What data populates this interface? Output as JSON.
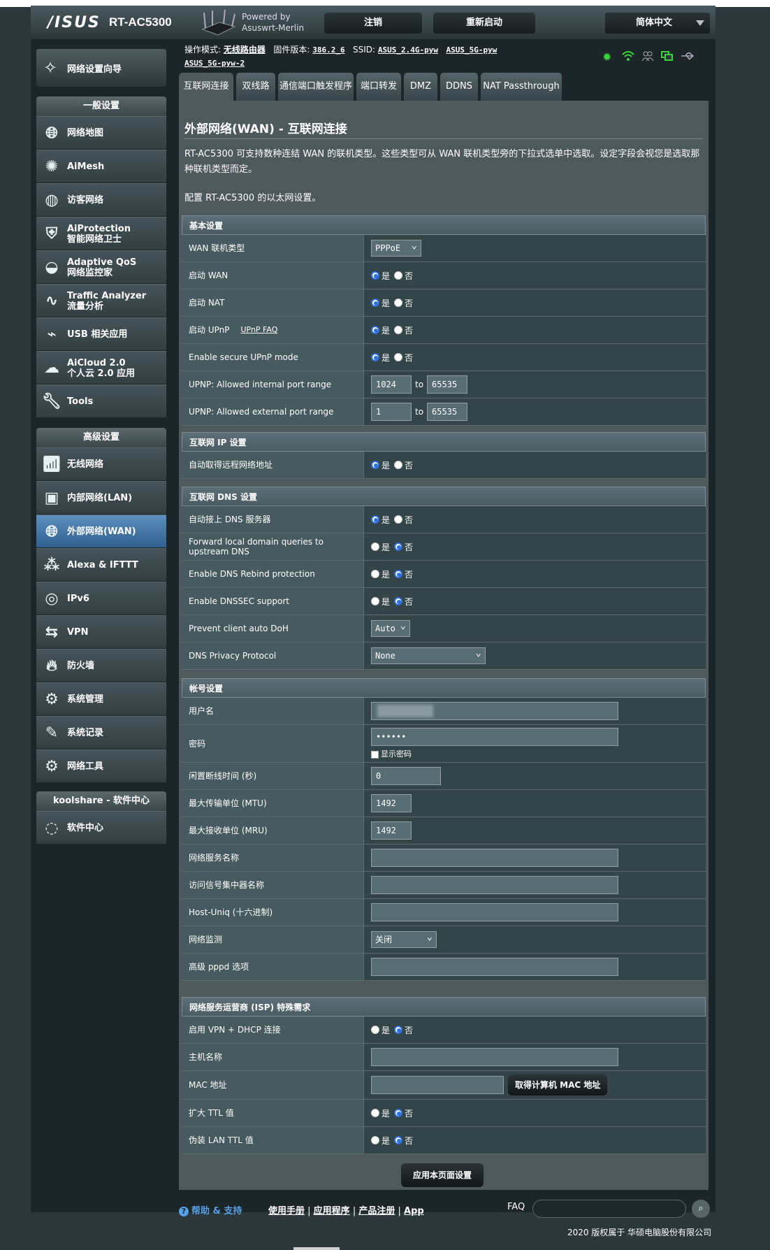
{
  "header": {
    "brand": "/ISUS",
    "model": "RT-AC5300",
    "powered_by_line1": "Powered by",
    "powered_by_line2": "Asuswrt-Merlin",
    "logout": "注销",
    "reboot": "重新启动",
    "language": "简体中文"
  },
  "opline": {
    "mode_label": "操作模式:",
    "mode_value": "无线路由器",
    "fw_label": "固件版本:",
    "fw_value": "386.2_6",
    "ssid_label": "SSID:",
    "ssid1": "ASUS_2.4G-pyw",
    "ssid2": "ASUS_5G-pyw",
    "ssid3": "ASUS_5G-pyw-2"
  },
  "sidebar": {
    "qis": "网络设置向导",
    "general_title": "一般设置",
    "general_items": [
      {
        "label": "网络地图",
        "icon": "globe"
      },
      {
        "label": "AiMesh",
        "icon": "mesh"
      },
      {
        "label": "访客网络",
        "icon": "guest"
      },
      {
        "label1": "AiProtection",
        "label2": "智能网络卫士",
        "icon": "shield"
      },
      {
        "label1": "Adaptive QoS",
        "label2": "网络监控家",
        "icon": "gauge"
      },
      {
        "label1": "Traffic Analyzer",
        "label2": "流量分析",
        "icon": "pulse"
      },
      {
        "label": "USB 相关应用",
        "icon": "usb"
      },
      {
        "label1": "AiCloud 2.0",
        "label2": "个人云 2.0 应用",
        "icon": "cloud"
      },
      {
        "label": "Tools",
        "icon": "wrench"
      }
    ],
    "advanced_title": "高级设置",
    "advanced_items": [
      {
        "label": "无线网络",
        "icon": "wifi"
      },
      {
        "label": "内部网络(LAN)",
        "icon": "lan"
      },
      {
        "label": "外部网络(WAN)",
        "icon": "wan"
      },
      {
        "label": "Alexa & IFTTT",
        "icon": "alexa"
      },
      {
        "label": "IPv6",
        "icon": "ipv6"
      },
      {
        "label": "VPN",
        "icon": "vpn"
      },
      {
        "label": "防火墙",
        "icon": "fire"
      },
      {
        "label": "系统管理",
        "icon": "admin"
      },
      {
        "label": "系统记录",
        "icon": "log"
      },
      {
        "label": "网络工具",
        "icon": "tools"
      }
    ],
    "koolshare_title": "koolshare - 软件中心",
    "koolshare_item": "软件中心"
  },
  "tabs": [
    "互联网连接",
    "双线路",
    "通信端口触发程序",
    "端口转发",
    "DMZ",
    "DDNS",
    "NAT Passthrough"
  ],
  "content": {
    "title": "外部网络(WAN) - 互联网连接",
    "desc": "RT-AC5300 可支持数种连结 WAN 的联机类型。这些类型可从 WAN 联机类型旁的下拉式选单中选取。设定字段会视您是选取那种联机类型而定。",
    "desc2": "配置 RT-AC5300 的以太网设置。",
    "yes": "是",
    "no": "否",
    "to": "to"
  },
  "basic": {
    "title": "基本设置",
    "wan_type_label": "WAN 联机类型",
    "wan_type_value": "PPPoE",
    "enable_wan": "启动 WAN",
    "enable_nat": "启动 NAT",
    "enable_upnp": "启动 UPnP",
    "upnp_faq": "UPnP FAQ",
    "secure_upnp": "Enable secure UPnP mode",
    "internal_range": "UPNP: Allowed internal port range",
    "internal_from": "1024",
    "internal_to": "65535",
    "external_range": "UPNP: Allowed external port range",
    "external_from": "1",
    "external_to": "65535"
  },
  "ip": {
    "title": "互联网 IP 设置",
    "auto_ip": "自动取得远程网络地址"
  },
  "dns": {
    "title": "互联网 DNS 设置",
    "auto_dns": "自动接上 DNS 服务器",
    "forward_local": "Forward local domain queries to upstream DNS",
    "rebind": "Enable DNS Rebind protection",
    "dnssec": "Enable DNSSEC support",
    "doh": "Prevent client auto DoH",
    "doh_value": "Auto",
    "privacy": "DNS Privacy Protocol",
    "privacy_value": "None"
  },
  "account": {
    "title": "帐号设置",
    "username": "用户名",
    "password": "密码",
    "password_value": "••••••",
    "show_password": "显示密码",
    "idle": "闲置断线时间 (秒)",
    "idle_value": "0",
    "mtu": "最大传输单位 (MTU)",
    "mtu_value": "1492",
    "mru": "最大接收单位 (MRU)",
    "mru_value": "1492",
    "service_name": "网络服务名称",
    "ac_name": "访问信号集中器名称",
    "host_uniq": "Host-Uniq (十六进制)",
    "monitor": "网络监测",
    "monitor_value": "关闭",
    "pppd": "高级 pppd 选项"
  },
  "isp": {
    "title": "网络服务运营商 (ISP) 特殊需求",
    "vpn_dhcp": "启用 VPN + DHCP 连接",
    "hostname": "主机名称",
    "mac": "MAC 地址",
    "mac_button": "取得计算机 MAC 地址",
    "ttl": "扩大 TTL 值",
    "spoof_ttl": "伪装 LAN TTL 值"
  },
  "apply": "应用本页面设置",
  "footer": {
    "help": "帮助 & 支持",
    "manual": "使用手册",
    "app_utility": "应用程序",
    "register": "产品注册",
    "app": "App",
    "faq": "FAQ",
    "copyright": "2020 版权属于 华硕电脑股份有限公司"
  }
}
